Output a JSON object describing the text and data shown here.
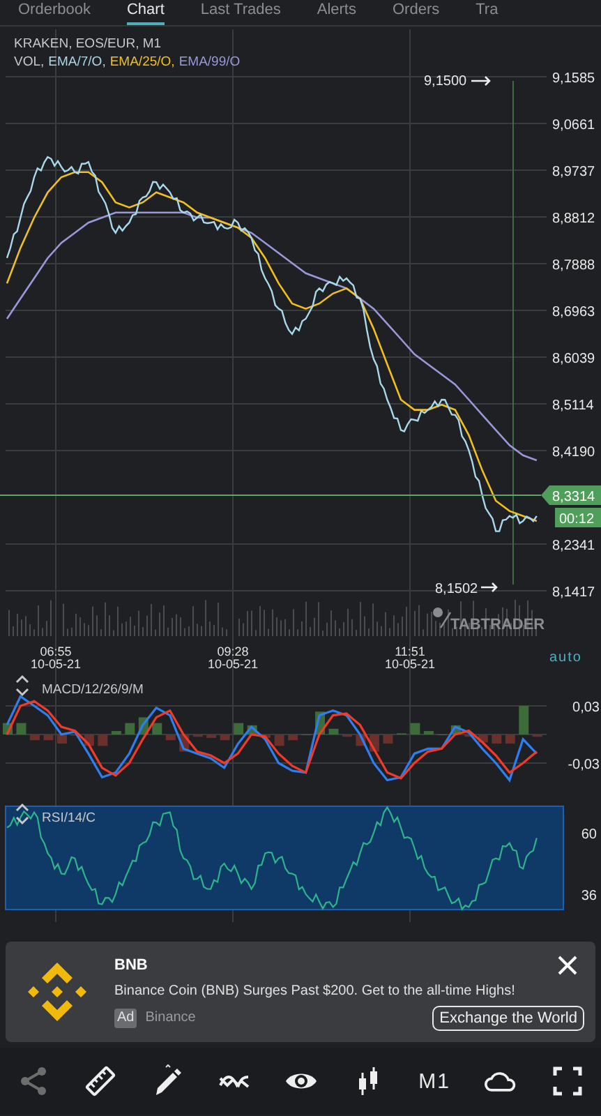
{
  "tabs": [
    {
      "label": "Orderbook",
      "selected": false
    },
    {
      "label": "Chart",
      "selected": true
    },
    {
      "label": "Last Trades",
      "selected": false
    },
    {
      "label": "Alerts",
      "selected": false
    },
    {
      "label": "Orders",
      "selected": false
    },
    {
      "label": "Tra",
      "selected": false
    }
  ],
  "price_chart": {
    "title": "KRAKEN, EOS/EUR, M1",
    "legend": [
      {
        "label": "VOL,",
        "color": "#c8c8c8"
      },
      {
        "label": "EMA/7/O,",
        "color": "#a8d8ea"
      },
      {
        "label": "EMA/25/O,",
        "color": "#f0c020"
      },
      {
        "label": "EMA/99/O",
        "color": "#9a98d8"
      }
    ],
    "axis_labels": [
      "9,1585",
      "9,0661",
      "8,9737",
      "8,8812",
      "8,7888",
      "8,6963",
      "8,6039",
      "8,5114",
      "8,4190",
      "8,2341",
      "8,1417"
    ],
    "high_marker": "9,1500",
    "low_marker": "8,1502",
    "price_tag": "8,3314",
    "countdown": "00:12",
    "logo_text": "TABTRADER",
    "scale_mode": "auto",
    "time_labels": [
      {
        "time": "06:55",
        "date": "10-05-21"
      },
      {
        "time": "09:28",
        "date": "10-05-21"
      },
      {
        "time": "11:51",
        "date": "10-05-21"
      }
    ]
  },
  "macd": {
    "label": "MACD/12/26/9/M",
    "axis_labels": [
      "0,03",
      "-0,03"
    ]
  },
  "rsi": {
    "label": "RSI/14/C",
    "axis_labels": [
      "60",
      "36"
    ]
  },
  "ad": {
    "title": "BNB",
    "text": "Binance Coin (BNB) Surges Past $200. Get to the all-time Highs!",
    "badge": "Ad",
    "advertiser": "Binance",
    "cta": "Exchange the World"
  },
  "toolbar": [
    {
      "kind": "share",
      "disabled": true
    },
    {
      "kind": "ruler",
      "disabled": false
    },
    {
      "kind": "draw",
      "disabled": false
    },
    {
      "kind": "indicators",
      "disabled": false
    },
    {
      "kind": "eye",
      "disabled": false
    },
    {
      "kind": "candles",
      "disabled": false
    },
    {
      "kind": "timeframe",
      "label": "M1",
      "disabled": false
    },
    {
      "kind": "cloud",
      "disabled": false
    },
    {
      "kind": "fullscreen",
      "disabled": false
    }
  ]
}
